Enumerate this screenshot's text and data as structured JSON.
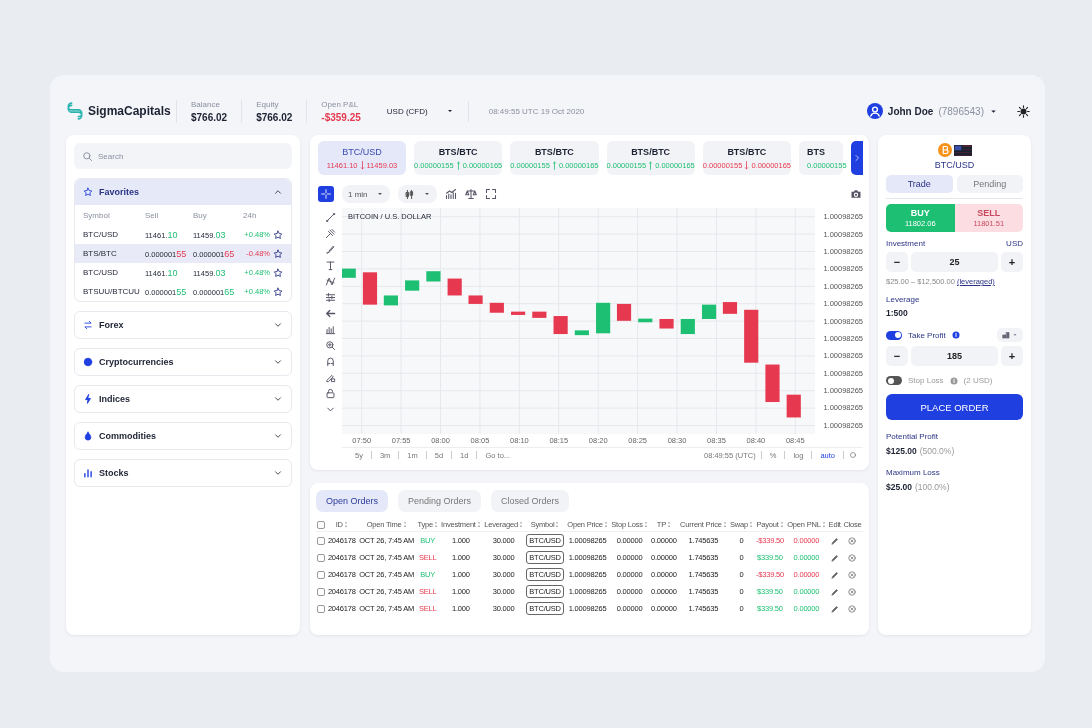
{
  "header": {
    "logo": "SigmaCapitals",
    "stats": [
      {
        "label": "Balance",
        "value": "$766.02",
        "negative": false
      },
      {
        "label": "Equity",
        "value": "$766.02",
        "negative": false
      },
      {
        "label": "Open P&L",
        "value": "-$359.25",
        "negative": true
      }
    ],
    "currency": "USD (CFD)",
    "datetime": "08:49:55 UTC 19 Oct 2020",
    "user": {
      "name": "John Doe",
      "account": "(7896543)"
    }
  },
  "sidebar": {
    "search": {
      "placeholder": "Search"
    },
    "sections": [
      {
        "title": "Favorites",
        "expanded": true,
        "columns": [
          "Symbol",
          "Sell",
          "Buy",
          "24h"
        ],
        "rows": [
          {
            "symbol": "BTC/USD",
            "sell": {
              "head": "11461.",
              "tail": "10"
            },
            "buy": {
              "head": "11459.",
              "tail": "03"
            },
            "change": "+0.48%",
            "rising": true,
            "selected": false
          },
          {
            "symbol": "BTS/BTC",
            "sell": {
              "head": "0.000001",
              "tail": "55"
            },
            "buy": {
              "head": "0.000001",
              "tail": "65"
            },
            "change": "-0.48%",
            "rising": false,
            "selected": true
          },
          {
            "symbol": "BTC/USD",
            "sell": {
              "head": "11461.",
              "tail": "10"
            },
            "buy": {
              "head": "11459.",
              "tail": "03"
            },
            "change": "+0.48%",
            "rising": true,
            "selected": false
          },
          {
            "symbol": "BTSUU/BTCUU",
            "sell": {
              "head": "0.000001",
              "tail": "55"
            },
            "buy": {
              "head": "0.000001",
              "tail": "65"
            },
            "change": "+0.48%",
            "rising": true,
            "selected": false
          }
        ]
      },
      {
        "title": "Forex",
        "expanded": false
      },
      {
        "title": "Cryptocurrencies",
        "expanded": false
      },
      {
        "title": "Indices",
        "expanded": false
      },
      {
        "title": "Commodities",
        "expanded": false
      },
      {
        "title": "Stocks",
        "expanded": false
      }
    ]
  },
  "tickers": [
    {
      "symbol": "BTC/USD",
      "bid": "11461.10",
      "ask": "11459.03",
      "rising": false,
      "selected": true
    },
    {
      "symbol": "BTS/BTC",
      "bid": "0.00000155",
      "ask": "0.00000165",
      "rising": true,
      "selected": false
    },
    {
      "symbol": "BTS/BTC",
      "bid": "0.00000155",
      "ask": "0.00000165",
      "rising": true,
      "selected": false
    },
    {
      "symbol": "BTS/BTC",
      "bid": "0.00000155",
      "ask": "0.00000165",
      "rising": true,
      "selected": false
    },
    {
      "symbol": "BTS/BTC",
      "bid": "0.00000155",
      "ask": "0.00000165",
      "rising": false,
      "selected": false
    },
    {
      "symbol": "BTS",
      "bid": "0.00000155",
      "rising": true,
      "selected": false
    }
  ],
  "chart": {
    "interval": "1 min",
    "title": "BITCOIN / U.S. DOLLAR",
    "y_labels": [
      "1.00098265",
      "1.00098265",
      "1.00098265",
      "1.00098265",
      "1.00098265",
      "1.00098265",
      "1.00098265",
      "1.00098265",
      "1.00098265",
      "1.00098265",
      "1.00098265",
      "1.00098265",
      "1.00098265"
    ],
    "x_labels": [
      "07:50",
      "07:55",
      "08:00",
      "08:05",
      "08:10",
      "08:15",
      "08:20",
      "08:25",
      "08:30",
      "08:35",
      "08:40",
      "08:45"
    ],
    "ranges": [
      "5y",
      "3m",
      "1m",
      "5d",
      "1d"
    ],
    "goto": "Go to...",
    "clock": "08:49:55 (UTC)",
    "scales": [
      {
        "label": "%",
        "selected": false
      },
      {
        "label": "log",
        "selected": false
      },
      {
        "label": "auto",
        "selected": true
      }
    ]
  },
  "orders": {
    "select_all": {
      "checked": false
    },
    "tabs": [
      {
        "label": "Open Orders",
        "selected": true
      },
      {
        "label": "Pending Orders",
        "selected": false
      },
      {
        "label": "Closed Orders",
        "selected": false
      }
    ],
    "columns": [
      {
        "label": "ID",
        "sortable": true
      },
      {
        "label": "Open Time",
        "sortable": true
      },
      {
        "label": "Type",
        "sortable": true
      },
      {
        "label": "Investment",
        "sortable": true
      },
      {
        "label": "Leveraged",
        "sortable": true
      },
      {
        "label": "Symbol",
        "sortable": true
      },
      {
        "label": "Open Price",
        "sortable": true
      },
      {
        "label": "Stop Loss",
        "sortable": true
      },
      {
        "label": "TP",
        "sortable": true
      },
      {
        "label": "Current Price",
        "sortable": true
      },
      {
        "label": "Swap",
        "sortable": true
      },
      {
        "label": "Payout",
        "sortable": true
      },
      {
        "label": "Open PNL",
        "sortable": true
      },
      {
        "label": "Edit",
        "sortable": false
      },
      {
        "label": "Close",
        "sortable": false
      }
    ],
    "rows": [
      {
        "checked": false,
        "id": "2046178",
        "open_time": "OCT 26, 7:45 AM",
        "type": "BUY",
        "kind": "buy",
        "investment": "1.000",
        "leveraged": "30.000",
        "symbol": "BTC/USD",
        "open_price": "1.00098265",
        "stop_loss": "0.00000",
        "tp": "0.00000",
        "current_price": "1.745635",
        "swap": "0",
        "payout": "-$339.50",
        "open_pnl": "0.00000",
        "profit": false
      },
      {
        "checked": false,
        "id": "2046178",
        "open_time": "OCT 26, 7:45 AM",
        "type": "SELL",
        "kind": "sell",
        "investment": "1.000",
        "leveraged": "30.000",
        "symbol": "BTC/USD",
        "open_price": "1.00098265",
        "stop_loss": "0.00000",
        "tp": "0.00000",
        "current_price": "1.745635",
        "swap": "0",
        "payout": "$339.50",
        "open_pnl": "0.00000",
        "profit": true
      },
      {
        "checked": false,
        "id": "2046178",
        "open_time": "OCT 26, 7:45 AM",
        "type": "BUY",
        "kind": "buy",
        "investment": "1.000",
        "leveraged": "30.000",
        "symbol": "BTC/USD",
        "open_price": "1.00098265",
        "stop_loss": "0.00000",
        "tp": "0.00000",
        "current_price": "1.745635",
        "swap": "0",
        "payout": "-$339.50",
        "open_pnl": "0.00000",
        "profit": false
      },
      {
        "checked": false,
        "id": "2046178",
        "open_time": "OCT 26, 7:45 AM",
        "type": "SELL",
        "kind": "sell",
        "investment": "1.000",
        "leveraged": "30.000",
        "symbol": "BTC/USD",
        "open_price": "1.00098265",
        "stop_loss": "0.00000",
        "tp": "0.00000",
        "current_price": "1.745635",
        "swap": "0",
        "payout": "$339.50",
        "open_pnl": "0.00000",
        "profit": true
      },
      {
        "checked": false,
        "id": "2046178",
        "open_time": "OCT 26, 7:45 AM",
        "type": "SELL",
        "kind": "sell",
        "investment": "1.000",
        "leveraged": "30.000",
        "symbol": "BTC/USD",
        "open_price": "1.00098265",
        "stop_loss": "0.00000",
        "tp": "0.00000",
        "current_price": "1.745635",
        "swap": "0",
        "payout": "$339.50",
        "open_pnl": "0.00000",
        "profit": true
      }
    ]
  },
  "trade": {
    "pair": "BTC/USD",
    "tabs": [
      {
        "label": "Trade",
        "selected": true
      },
      {
        "label": "Pending",
        "selected": false
      }
    ],
    "sides": [
      {
        "label": "BUY",
        "price": "11802.06",
        "kind": "buy",
        "selected": true
      },
      {
        "label": "SELL",
        "price": "11801.51",
        "kind": "sell",
        "selected": false
      }
    ],
    "investment": {
      "label": "Investment",
      "currency": "USD",
      "stepper": {
        "minus": "−",
        "value": "25",
        "plus": "+"
      },
      "range": "$25.00 – $12,500.00",
      "link": "(leveraged)"
    },
    "leverage": {
      "label": "Leverage",
      "value": "1:500"
    },
    "take_profit": {
      "label": "Take Profit",
      "on": true,
      "stepper": {
        "minus": "−",
        "value": "185",
        "plus": "+"
      }
    },
    "stop_loss": {
      "label": "Stop Loss",
      "on": false,
      "note": "(2 USD)"
    },
    "button": "PLACE ORDER",
    "summary": [
      {
        "label": "Potential Profit",
        "value": "$125.00",
        "percent": "(500.0%)"
      },
      {
        "label": "Maximum Loss",
        "value": "$25.00",
        "percent": "(100.0%)"
      }
    ]
  }
}
